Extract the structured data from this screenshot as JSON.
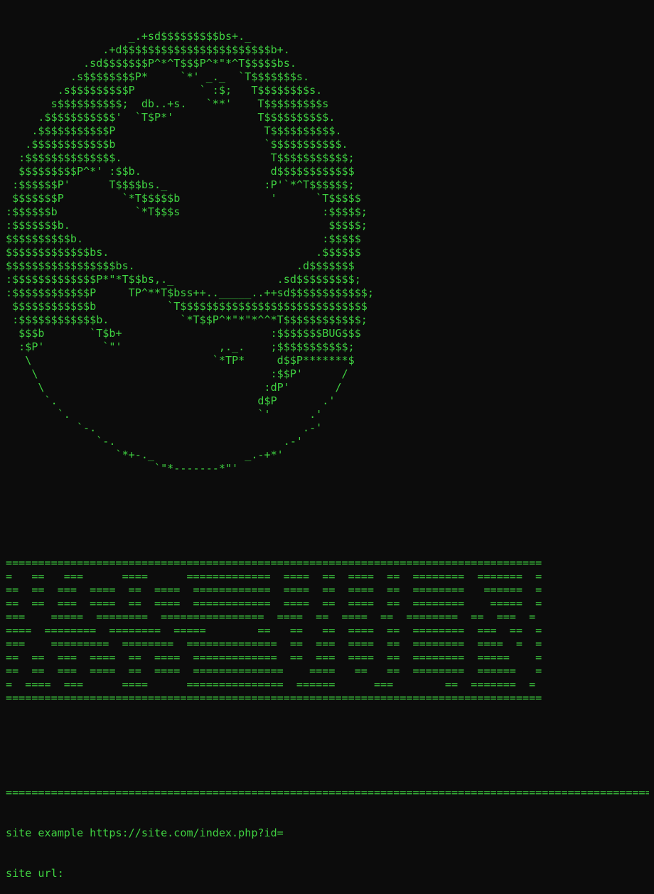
{
  "terminal": {
    "colors": {
      "background": "#0c0c0c",
      "text": "#3fd141"
    },
    "logo_art": "                   _.+sd$$$$$$$$$bs+._\n               .+d$$$$$$$$$$$$$$$$$$$$$$$b+.\n            .sd$$$$$$$P^*^T$$$P^*\"*^T$$$$$bs.\n          .s$$$$$$$$P*     `*' _._  `T$$$$$$$s.\n        .s$$$$$$$$$P          ` :$;   T$$$$$$$$s.\n       s$$$$$$$$$$;  db..+s.   `**'    T$$$$$$$$$s\n     .$$$$$$$$$$$'  `T$P*'             T$$$$$$$$$$.\n    .$$$$$$$$$$$P                       T$$$$$$$$$$.\n   .$$$$$$$$$$$$b                       `$$$$$$$$$$$.\n  :$$$$$$$$$$$$$$.                       T$$$$$$$$$$$;\n  $$$$$$$$$P^*' :$$b.                    d$$$$$$$$$$$$\n :$$$$$$P'      T$$$$bs._               :P'`*^T$$$$$$;\n $$$$$$$P         `*T$$$$$b              '      `T$$$$$\n:$$$$$$b            `*T$$$s                      :$$$$$;\n:$$$$$$$b.                                        $$$$$;\n$$$$$$$$$$b.                                     :$$$$$\n$$$$$$$$$$$$$bs.                                .$$$$$$\n$$$$$$$$$$$$$$$$$bs.                         .d$$$$$$$\n:$$$$$$$$$$$$$P*\"*T$$bs,._                .sd$$$$$$$$$;\n:$$$$$$$$$$$$P     TP^**T$bss++.._____..++sd$$$$$$$$$$$$;\n $$$$$$$$$$$$b           `T$$$$$$$$$$$$$$$$$$$$$$$$$$$$$\n :$$$$$$$$$$$$b.           `*T$$P^*\"*\"*^^*T$$$$$$$$$$$$;\n  $$$b       `T$b+                       :$$$$$$$BUG$$$\n  :$P'         `\"'               ,._.    ;$$$$$$$$$$$;\n   \\                            `*TP*     d$$P*******$\n    \\                                    :$$P'      /\n     \\                                  :dP'       /\n      `.                               d$P       .'\n        `.                             `'      .'\n           `-.                                .-'\n              `-.                          .-'\n                 `*+-._              _.-+*'\n                       `\"*-------*\"'",
    "banner_art": "===================================================================================\n=   ==   ===      ====      =============  ====  ==  ====  ==  ========  =======  =\n==  ==  ===  ====  ==  ====  ============  ====  ==  ====  ==  ========   ======  =\n==  ==  ===  ====  ==  ====  ============  ====  ==  ====  ==  ========    =====  =\n===    =====  ========  ================  ====  ==  ====  ==  ========  ==  ===  =\n====  ========  ========  =====        ==   ==   ==  ====  ==  ========  ===  ==  =\n===    =========  ========  ==============  ==  ===  ====  ==  ========  ====  =  =\n==  ==  ===  ====  ==  ====  =============  ==  ===  ====  ==  ========  =====    =\n==  ==  ===  ====  ==  ====  ==============    ====   ==   ==  ========  ======   =\n=  ====  ===      ====      ===============  ======      ===        ==  =======  =\n===================================================================================",
    "separator_line": "====================================================================================================",
    "example_line": "site example https://site.com/index.php?id=",
    "prompt_label": "site url:",
    "input_value": ""
  }
}
